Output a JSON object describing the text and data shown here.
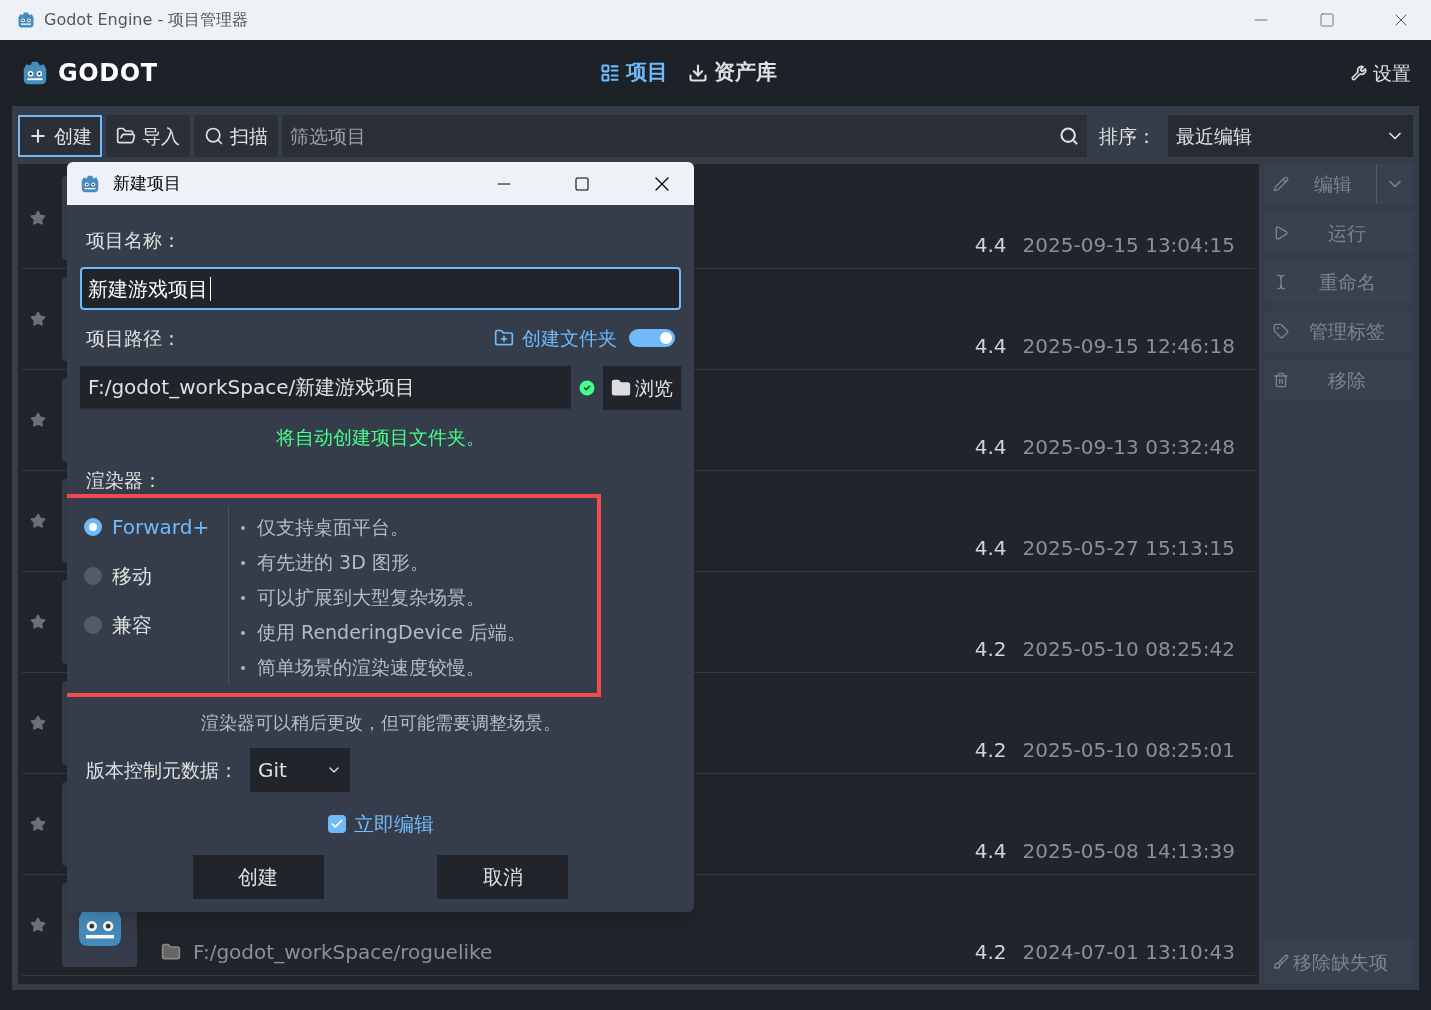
{
  "window": {
    "title": "Godot Engine - 项目管理器"
  },
  "header": {
    "logo": "GODOT",
    "tabs": [
      {
        "label": "项目",
        "selected": true
      },
      {
        "label": "资产库",
        "selected": false
      }
    ],
    "settings": "设置"
  },
  "toolbar": {
    "buttons": [
      {
        "label": "创建",
        "kind": "create",
        "focused": true
      },
      {
        "label": "导入",
        "kind": "import",
        "focused": false
      },
      {
        "label": "扫描",
        "kind": "scan",
        "focused": false
      }
    ],
    "filter_placeholder": "筛选项目",
    "sort_label": "排序：",
    "sort_value": "最近编辑"
  },
  "projects": [
    {
      "version": "4.4",
      "modified": "2025-09-15 13:04:15"
    },
    {
      "version": "4.4",
      "modified": "2025-09-15 12:46:18"
    },
    {
      "version": "4.4",
      "modified": "2025-09-13 03:32:48"
    },
    {
      "version": "4.4",
      "modified": "2025-05-27 15:13:15"
    },
    {
      "version": "4.2",
      "modified": "2025-05-10 08:25:42"
    },
    {
      "version": "4.2",
      "modified": "2025-05-10 08:25:01"
    },
    {
      "version": "4.4",
      "modified": "2025-05-08 14:13:39"
    },
    {
      "path": "F:/godot_workSpace/roguelike",
      "version": "4.2",
      "modified": "2024-07-01 13:10:43"
    }
  ],
  "actions": [
    {
      "label": "编辑",
      "kind": "edit",
      "disabled": true
    },
    {
      "label": "运行",
      "kind": "run",
      "disabled": true
    },
    {
      "label": "重命名",
      "kind": "rename",
      "disabled": true
    },
    {
      "label": "管理标签",
      "kind": "tags",
      "disabled": true
    },
    {
      "label": "移除",
      "kind": "remove",
      "disabled": true
    }
  ],
  "remove_missing": "移除缺失项",
  "dialog": {
    "title": "新建项目",
    "name_label": "项目名称：",
    "name_value": "新建游戏项目",
    "path_label": "项目路径：",
    "create_folder": {
      "label": "创建文件夹",
      "on": true
    },
    "path_value": "F:/godot_workSpace/新建游戏项目",
    "browse": "浏览",
    "status": "将自动创建项目文件夹。",
    "renderer_label": "渲染器：",
    "renderers": [
      {
        "label": "Forward+",
        "selected": true
      },
      {
        "label": "移动",
        "selected": false
      },
      {
        "label": "兼容",
        "selected": false
      }
    ],
    "renderer_features": [
      "仅支持桌面平台。",
      "有先进的 3D 图形。",
      "可以扩展到大型复杂场景。",
      "使用 RenderingDevice 后端。",
      "简单场景的渲染速度较慢。"
    ],
    "renderer_note": "渲染器可以稍后更改，但可能需要调整场景。",
    "vcs_label": "版本控制元数据：",
    "vcs_value": "Git",
    "edit_now": {
      "label": "立即编辑",
      "checked": true
    },
    "buttons": [
      "创建",
      "取消"
    ]
  }
}
